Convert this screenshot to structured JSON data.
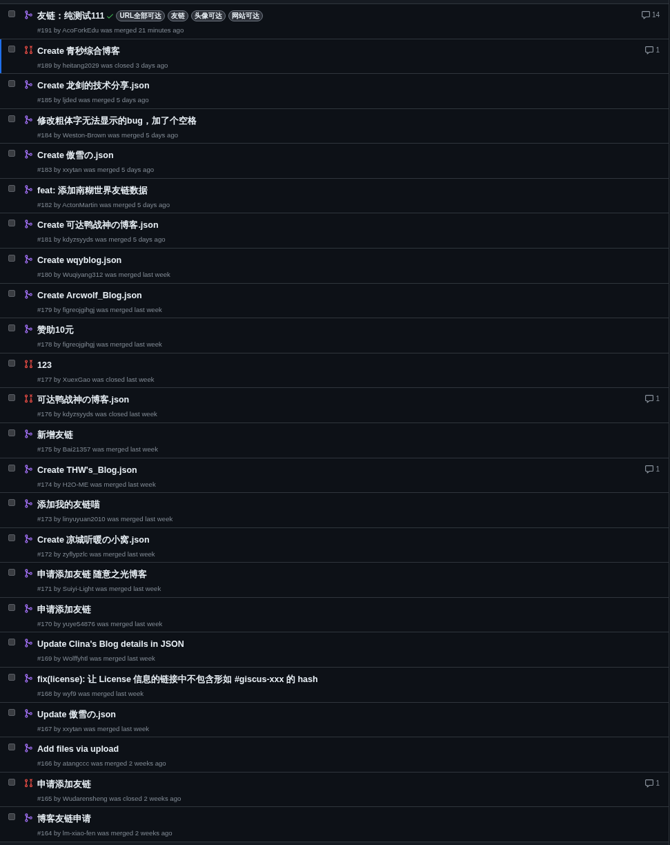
{
  "pull_requests": [
    {
      "kind": "merged",
      "title": "友链：纯测试111",
      "checks_passed": true,
      "labels": [
        "URL全部可达",
        "友链",
        "头像可达",
        "网站可达"
      ],
      "meta": "#191 by AcoForkEdu was merged 21 minutes ago",
      "comments": "14",
      "checked": false,
      "focused": false
    },
    {
      "kind": "closed",
      "title": "Create 青秒综合博客",
      "checks_passed": false,
      "meta": "#189 by heitang2029 was closed 3 days ago",
      "comments": "1",
      "checked": false,
      "focused": true
    },
    {
      "kind": "merged",
      "title": "Create 龙剑的技术分享.json",
      "checks_passed": false,
      "meta": "#185 by ljded was merged 5 days ago",
      "checked": false,
      "focused": false
    },
    {
      "kind": "merged",
      "title": "修改粗体字无法显示的bug，加了个空格",
      "checks_passed": false,
      "meta": "#184 by Weston-Brown was merged 5 days ago",
      "checked": false,
      "focused": false
    },
    {
      "kind": "merged",
      "title": "Create 傲雪の.json",
      "checks_passed": false,
      "meta": "#183 by xxytan was merged 5 days ago",
      "checked": false,
      "focused": false
    },
    {
      "kind": "merged",
      "title": "feat: 添加南糊世界友链数据",
      "checks_passed": false,
      "meta": "#182 by ActonMartin was merged 5 days ago",
      "checked": false,
      "focused": false
    },
    {
      "kind": "merged",
      "title": "Create 可达鸭战神の博客.json",
      "checks_passed": false,
      "meta": "#181 by kdyzsyyds was merged 5 days ago",
      "checked": false,
      "focused": false
    },
    {
      "kind": "merged",
      "title": "Create wqyblog.json",
      "checks_passed": false,
      "meta": "#180 by Wuqiyang312 was merged last week",
      "checked": false,
      "focused": false
    },
    {
      "kind": "merged",
      "title": "Create Arcwolf_Blog.json",
      "checks_passed": false,
      "meta": "#179 by figreojgihgj was merged last week",
      "checked": false,
      "focused": false
    },
    {
      "kind": "merged",
      "title": "赞助10元",
      "checks_passed": false,
      "meta": "#178 by figreojgihgj was merged last week",
      "checked": false,
      "focused": false
    },
    {
      "kind": "closed",
      "title": "123",
      "checks_passed": false,
      "meta": "#177 by XuexGao was closed last week",
      "checked": false,
      "focused": false
    },
    {
      "kind": "closed",
      "title": "可达鸭战神の博客.json",
      "checks_passed": false,
      "meta": "#176 by kdyzsyyds was closed last week",
      "comments": "1",
      "checked": false,
      "focused": false
    },
    {
      "kind": "merged",
      "title": "新增友链",
      "checks_passed": false,
      "meta": "#175 by Bai21357 was merged last week",
      "checked": false,
      "focused": false
    },
    {
      "kind": "merged",
      "title": "Create THW's_Blog.json",
      "checks_passed": false,
      "meta": "#174 by H2O-ME was merged last week",
      "comments": "1",
      "checked": false,
      "focused": false
    },
    {
      "kind": "merged",
      "title": "添加我的友链喵",
      "checks_passed": false,
      "meta": "#173 by linyuyuan2010 was merged last week",
      "checked": false,
      "focused": false
    },
    {
      "kind": "merged",
      "title": "Create 凉城听暖の小窝.json",
      "checks_passed": false,
      "meta": "#172 by zyflypzlc was merged last week",
      "checked": false,
      "focused": false
    },
    {
      "kind": "merged",
      "title": "申请添加友链 随意之光博客",
      "checks_passed": false,
      "meta": "#171 by Suiyi-Light was merged last week",
      "checked": false,
      "focused": false
    },
    {
      "kind": "merged",
      "title": "申请添加友链",
      "checks_passed": false,
      "meta": "#170 by yuye54876 was merged last week",
      "checked": false,
      "focused": false
    },
    {
      "kind": "merged",
      "title": "Update Clina's Blog details in JSON",
      "checks_passed": false,
      "meta": "#169 by Wolffyhtl was merged last week",
      "checked": false,
      "focused": false
    },
    {
      "kind": "merged",
      "title": "fix(license): 让 License 信息的链接中不包含形如 #giscus-xxx 的 hash",
      "checks_passed": false,
      "meta": "#168 by wyf9 was merged last week",
      "checked": false,
      "focused": false
    },
    {
      "kind": "merged",
      "title": "Update 傲雪の.json",
      "checks_passed": false,
      "meta": "#167 by xxytan was merged last week",
      "checked": false,
      "focused": false
    },
    {
      "kind": "merged",
      "title": "Add files via upload",
      "checks_passed": false,
      "meta": "#166 by atangccc was merged 2 weeks ago",
      "checked": false,
      "focused": false
    },
    {
      "kind": "closed",
      "title": "申请添加友链",
      "checks_passed": false,
      "meta": "#165 by Wudarensheng was closed 2 weeks ago",
      "comments": "1",
      "checked": false,
      "focused": false
    },
    {
      "kind": "merged",
      "title": "博客友链申请",
      "checks_passed": false,
      "meta": "#164 by lm-xiao-fen was merged 2 weeks ago",
      "checked": false,
      "focused": false
    }
  ]
}
